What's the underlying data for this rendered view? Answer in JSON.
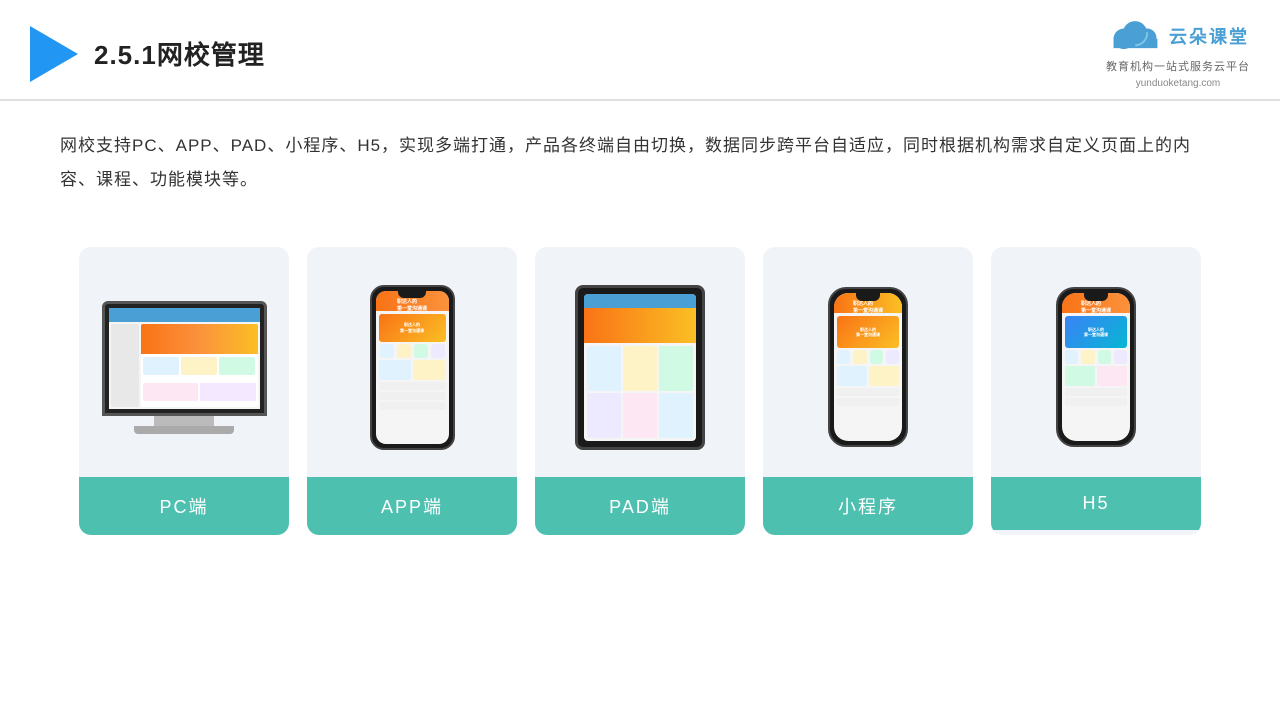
{
  "header": {
    "title": "2.5.1网校管理",
    "brand": {
      "name": "云朵课堂",
      "tagline": "教育机构一站式服务云平台",
      "url": "yunduoketang.com"
    }
  },
  "description": "网校支持PC、APP、PAD、小程序、H5，实现多端打通，产品各终端自由切换，数据同步跨平台自适应，同时根据机构需求自定义页面上的内容、课程、功能模块等。",
  "cards": [
    {
      "id": "pc",
      "label": "PC端"
    },
    {
      "id": "app",
      "label": "APP端"
    },
    {
      "id": "pad",
      "label": "PAD端"
    },
    {
      "id": "miniprogram",
      "label": "小程序"
    },
    {
      "id": "h5",
      "label": "H5"
    }
  ]
}
